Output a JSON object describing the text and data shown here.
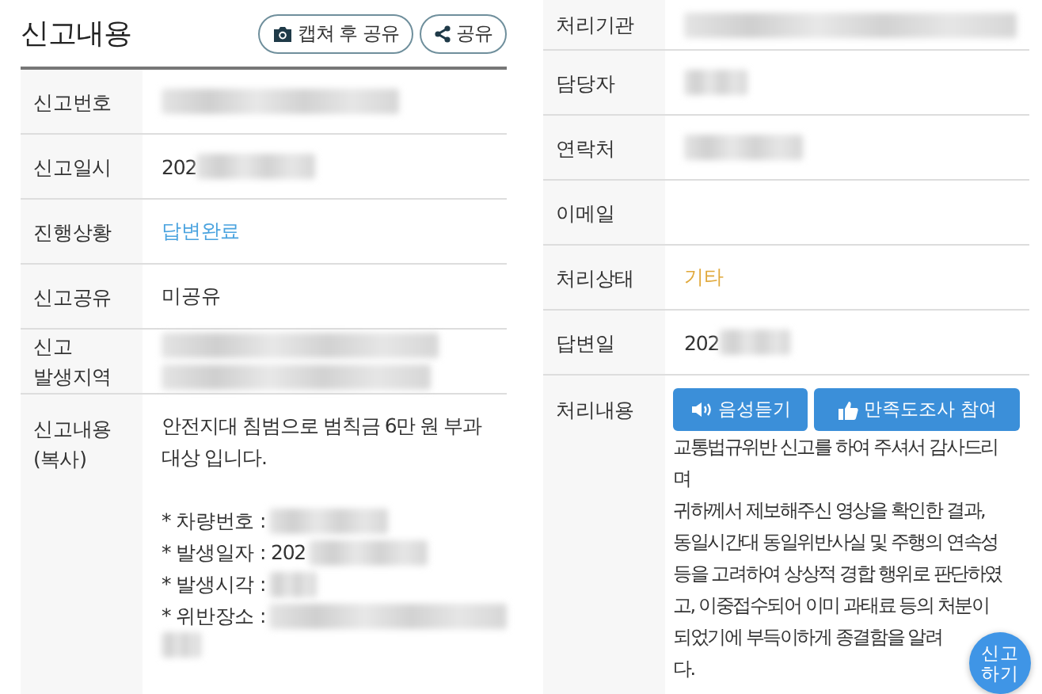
{
  "report": {
    "title": "신고내용",
    "actions": [
      {
        "kind": "capture",
        "label": "캡쳐 후 공유"
      },
      {
        "kind": "share",
        "label": "공유"
      }
    ],
    "fields": [
      {
        "label": "신고번호",
        "blurred": true
      },
      {
        "label": "신고일시",
        "value": "202",
        "blurred": true
      },
      {
        "label": "진행상황",
        "value": "답변완료",
        "color": "#4aa3df"
      },
      {
        "label": "신고공유",
        "value": "미공유"
      },
      {
        "label": "신고 발생지역",
        "blurred": true,
        "wrapped": true
      }
    ],
    "content": {
      "label": "신고내용 (복사)",
      "text": "안전지대 침범으로 범칙금 6만 원 부과 대상 입니다.",
      "details": [
        {
          "label": "* 차량번호 :",
          "blurred": true
        },
        {
          "label": "* 발생일자 : 202",
          "blurred": true
        },
        {
          "label": "* 발생시각 :",
          "blurred": true
        },
        {
          "label": "* 위반장소 :",
          "blurred": true,
          "wrapped": true
        }
      ]
    }
  },
  "processing": {
    "fields": [
      {
        "label": "처리기관",
        "blurred": true
      },
      {
        "label": "담당자",
        "blurred": true
      },
      {
        "label": "연락처",
        "blurred": true
      },
      {
        "label": "이메일"
      },
      {
        "label": "처리상태",
        "value": "기타",
        "color": "#e0a83a"
      },
      {
        "label": "답변일",
        "value": "202",
        "blurred": true
      }
    ],
    "answer": {
      "label": "처리내용",
      "buttons": [
        {
          "kind": "listen",
          "label": "음성듣기"
        },
        {
          "kind": "survey",
          "label": "만족도조사 참여"
        }
      ],
      "lines": [
        "교통법규위반 신고를 하여 주셔서 감사드리",
        "며",
        "귀하께서 제보해주신 영상을 확인한 결과,",
        "동일시간대 동일위반사실 및 주행의 연속성",
        "등을 고려하여 상상적 경합 행위로 판단하였",
        "고, 이중접수되어 이미 과태료 등의 처분이",
        "되었기에 부득이하게 종결함을 알려",
        "다."
      ]
    }
  },
  "fab": {
    "label_lines": [
      "신고",
      "하기"
    ]
  }
}
